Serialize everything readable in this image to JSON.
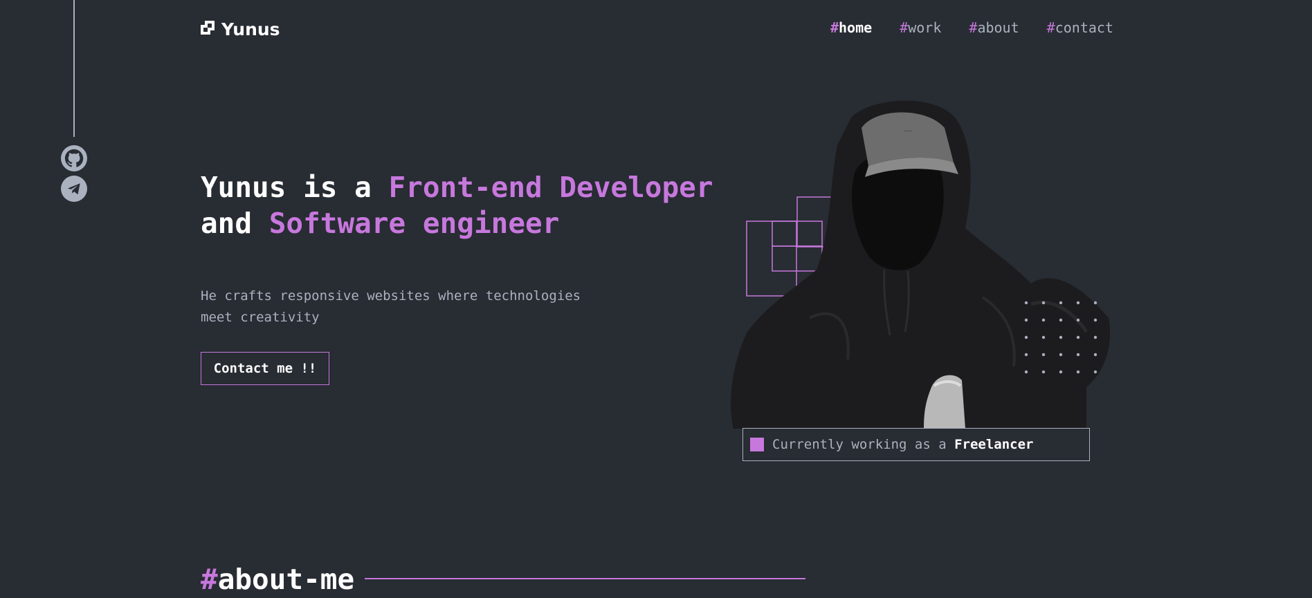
{
  "brand": {
    "name": "Yunus",
    "logo_icon": "logo-icon"
  },
  "nav": {
    "items": [
      {
        "hash": "#",
        "label": "home",
        "active": true
      },
      {
        "hash": "#",
        "label": "work",
        "active": false
      },
      {
        "hash": "#",
        "label": "about",
        "active": false
      },
      {
        "hash": "#",
        "label": "contact",
        "active": false
      }
    ]
  },
  "social": {
    "items": [
      {
        "icon": "github-icon"
      },
      {
        "icon": "telegram-icon"
      }
    ]
  },
  "hero": {
    "title_part1": "Yunus is a ",
    "title_highlight1": "Front-end Developer",
    "title_part2": "and ",
    "title_highlight2": "Software engineer",
    "description_line1": "He crafts responsive websites where technologies",
    "description_line2": "meet creativity",
    "cta_label": "Contact me !!"
  },
  "status": {
    "prefix": "Currently working as a ",
    "role": "Freelancer"
  },
  "about": {
    "hash": "#",
    "title": "about-me"
  },
  "colors": {
    "background": "#282c33",
    "accent": "#c778dd",
    "muted": "#abb2bf",
    "text": "#ffffff"
  }
}
